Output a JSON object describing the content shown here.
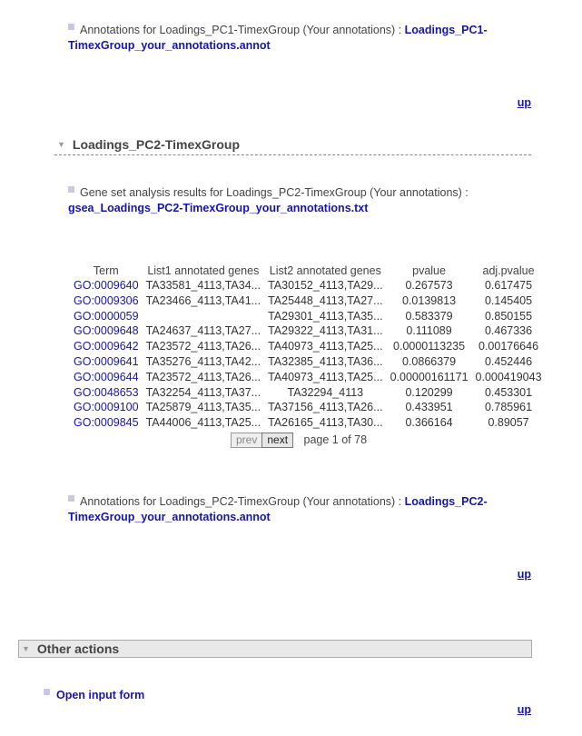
{
  "pc1_annot": {
    "prefix": "Annotations for Loadings_PC1-TimexGroup (Your annotations) : ",
    "link": "Loadings_PC1-TimexGroup_your_annotations.annot"
  },
  "up_label": "up",
  "section": {
    "title": "Loadings_PC2-TimexGroup"
  },
  "gsea": {
    "prefix": "Gene set analysis results for Loadings_PC2-TimexGroup (Your annotations) :",
    "link": "gsea_Loadings_PC2-TimexGroup_your_annotations.txt"
  },
  "table": {
    "headers": [
      "Term",
      "List1 annotated genes",
      "List2 annotated genes",
      "pvalue",
      "adj.pvalue"
    ],
    "rows": [
      [
        "GO:0009640",
        "TA33581_4113,TA34...",
        "TA30152_4113,TA29...",
        "0.267573",
        "0.617475"
      ],
      [
        "GO:0009306",
        "TA23466_4113,TA41...",
        "TA25448_4113,TA27...",
        "0.0139813",
        "0.145405"
      ],
      [
        "GO:0000059",
        "",
        "TA29301_4113,TA35...",
        "0.583379",
        "0.850155"
      ],
      [
        "GO:0009648",
        "TA24637_4113,TA27...",
        "TA29322_4113,TA31...",
        "0.111089",
        "0.467336"
      ],
      [
        "GO:0009642",
        "TA23572_4113,TA26...",
        "TA40973_4113,TA25...",
        "0.0000113235",
        "0.00176646"
      ],
      [
        "GO:0009641",
        "TA35276_4113,TA42...",
        "TA32385_4113,TA36...",
        "0.0866379",
        "0.452446"
      ],
      [
        "GO:0009644",
        "TA23572_4113,TA26...",
        "TA40973_4113,TA25...",
        "0.00000161171",
        "0.000419043"
      ],
      [
        "GO:0048653",
        "TA32254_4113,TA37...",
        "TA32294_4113",
        "0.120299",
        "0.453301"
      ],
      [
        "GO:0009100",
        "TA25879_4113,TA35...",
        "TA37156_4113,TA26...",
        "0.433951",
        "0.785961"
      ],
      [
        "GO:0009845",
        "TA44006_4113,TA25...",
        "TA26165_4113,TA30...",
        "0.366164",
        "0.89057"
      ]
    ]
  },
  "pager": {
    "prev": "prev",
    "next": "next",
    "info": "page 1 of 78"
  },
  "pc2_annot": {
    "prefix": "Annotations for Loadings_PC2-TimexGroup (Your annotations) : ",
    "link": "Loadings_PC2-TimexGroup_your_annotations.annot"
  },
  "other_actions": {
    "title": "Other actions",
    "open_input_form": "Open input form"
  }
}
